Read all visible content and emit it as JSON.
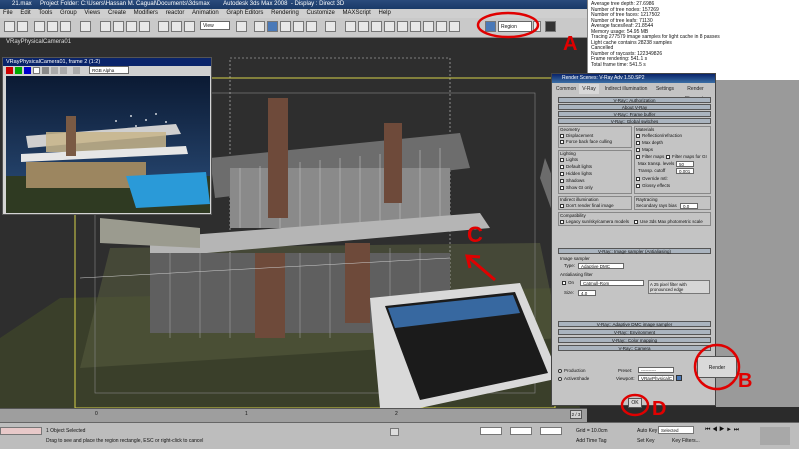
{
  "title_bar": {
    "file": "21.max",
    "folder": "Project Folder: C:\\Users\\Hassan M. Cagual\\Documents\\3dsmax",
    "app": "Autodesk 3ds Max 2008",
    "display": "- Display : Direct 3D"
  },
  "menus": [
    "File",
    "Edit",
    "Tools",
    "Group",
    "Views",
    "Create",
    "Modifiers",
    "reactor",
    "Animation",
    "Graph Editors",
    "Rendering",
    "Customize",
    "MAXScript",
    "Help"
  ],
  "toolbar": {
    "view_dropdown": "View",
    "region_dropdown": "Region"
  },
  "viewport": {
    "label": "VRayPhysicalCamera01"
  },
  "vfb": {
    "title": "VRayPhysicalCamera01, frame 2 (1:2)",
    "channel": "RGB Alpha"
  },
  "render_log": [
    "Average tree depth: 27.6986",
    "Number of tree nodes: 157269",
    "Number of tree faces: 1217502",
    "Number of tree leafs: 71130",
    "Average faces/leaf: 21.8544",
    "Memory usage: 54.95 MB",
    "Tracing 277579 image samples for light cache in 8 passes",
    "Light cache contains 28238 samples",
    "Cancelled",
    "Number of raycasts: 122349826",
    "Frame rendering: 541.1 s",
    "Total frame time: 541.5 s"
  ],
  "render_setup": {
    "title": "Render Scenes: V-Ray Adv 1.50.SP2",
    "tabs": [
      "Common",
      "V-Ray",
      "Indirect illumination",
      "Settings",
      "Render Elements"
    ],
    "rollouts_top": [
      "V-Ray:: Authorization",
      "About V-Ray",
      "V-Ray:: Frame buffer",
      "V-Ray:: Global switches"
    ],
    "geometry": {
      "label": "Geometry",
      "displacement": "Displacement",
      "force_back": "Force back face culling"
    },
    "lighting": {
      "label": "Lighting",
      "lights": "Lights",
      "default_lights": "Default lights",
      "hidden_lights": "Hidden lights",
      "shadows": "Shadows",
      "show_gi": "Show GI only"
    },
    "indirect": {
      "label": "Indirect illumination",
      "dont_render": "Don't render final image"
    },
    "compat": {
      "label": "Compatibility",
      "legacy": "Legacy sun/sky/camera models",
      "use3ds": "Use 3ds Max photometric scale"
    },
    "materials": {
      "label": "Materials",
      "reflection": "Reflection/refraction",
      "max_depth": "Max depth",
      "maps": "Maps",
      "filter_maps": "Filter maps",
      "filter_gi": "Filter maps for GI",
      "max_transp": "Max transp. levels",
      "max_transp_val": "50",
      "transp_cutoff": "Transp. cutoff",
      "transp_cutoff_val": "0.001",
      "override": "Override mtl:",
      "glossy": "Glossy effects"
    },
    "raytracing": {
      "label": "Raytracing",
      "secondary": "Secondary rays bias",
      "secondary_val": "0.0"
    },
    "image_sampler_rollout": "V-Ray:: Image sampler (Antialiasing)",
    "image_sampler": {
      "label": "Image sampler",
      "type_label": "Type:",
      "type_val": "Adaptive DMC"
    },
    "aa_filter": {
      "label": "Antialiasing filter",
      "on": "On",
      "filter_val": "Catmull-Rom",
      "size_label": "Size:",
      "size_val": "4.0",
      "description": "A 25 pixel filter with pronounced edge enhancement effects."
    },
    "rollouts_bottom": [
      "V-Ray:: Adaptive DMC image sampler",
      "V-Ray:: Environment",
      "V-Ray:: Color mapping",
      "V-Ray:: Camera"
    ],
    "production": "Production",
    "active_shade": "ActiveShade",
    "preset_label": "Preset:",
    "preset_val": "----------",
    "viewport_label": "Viewport:",
    "viewport_val": "VRayPhysicalC",
    "render_button": "Render"
  },
  "bottom": {
    "frame_counter": "2 / 3",
    "ok_button": "OK",
    "status_objects": "1 Object Selected",
    "status_prompt": "Drag to see and place the region rectangle, ESC or right-click to cancel",
    "grid": "Grid = 10.0cm",
    "add_time_tag": "Add Time Tag",
    "auto_key": "Auto Key",
    "auto_key_val": "Selected",
    "set_key": "Set Key",
    "key_filters": "Key Filters...",
    "timeline_ticks": [
      "0",
      "1",
      "2"
    ]
  },
  "annotations": {
    "a": "A",
    "b": "B",
    "c": "C",
    "d": "D"
  },
  "colors": {
    "annotation": "#e00000",
    "title_bar": "#193a68",
    "rollout": "#aab4bf"
  }
}
